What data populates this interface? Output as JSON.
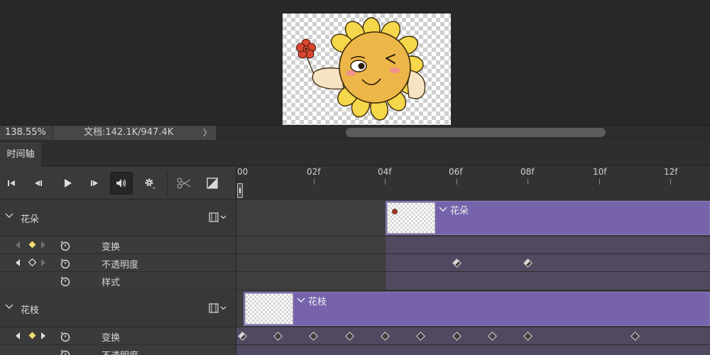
{
  "status": {
    "zoom": "138.55%",
    "doc_info": "文档:142.1K/947.4K",
    "arrow": "〉"
  },
  "panel": {
    "tab_label": "时间轴"
  },
  "controls": [
    {
      "name": "go-to-first-frame-button",
      "icon": "skip-first-icon"
    },
    {
      "name": "previous-frame-button",
      "icon": "step-back-icon"
    },
    {
      "name": "play-button",
      "icon": "play-icon"
    },
    {
      "name": "next-frame-button",
      "icon": "step-forward-icon"
    },
    {
      "name": "audio-toggle-button",
      "icon": "speaker-icon"
    },
    {
      "name": "settings-button",
      "icon": "gear-icon"
    },
    {
      "name": "split-at-playhead-button",
      "icon": "scissors-icon"
    },
    {
      "name": "transition-button",
      "icon": "transition-icon"
    }
  ],
  "ruler": {
    "ticks": [
      "00",
      "02f",
      "04f",
      "06f",
      "08f",
      "10f",
      "12f"
    ]
  },
  "layers": [
    {
      "name": "花朵",
      "clip_label": "花朵",
      "properties": [
        {
          "label": "变换",
          "keyframe_state": "active"
        },
        {
          "label": "不透明度",
          "keyframe_state": "empty"
        },
        {
          "label": "样式",
          "keyframe_state": "none"
        }
      ]
    },
    {
      "name": "花枝",
      "clip_label": "花枝",
      "properties": [
        {
          "label": "变换",
          "keyframe_state": "active"
        },
        {
          "label": "不透明度",
          "keyframe_state": "none"
        }
      ]
    }
  ],
  "colors": {
    "clip": "#7663ab",
    "keyframe_active": "#f2dc6e",
    "panel_bg": "#383838"
  }
}
